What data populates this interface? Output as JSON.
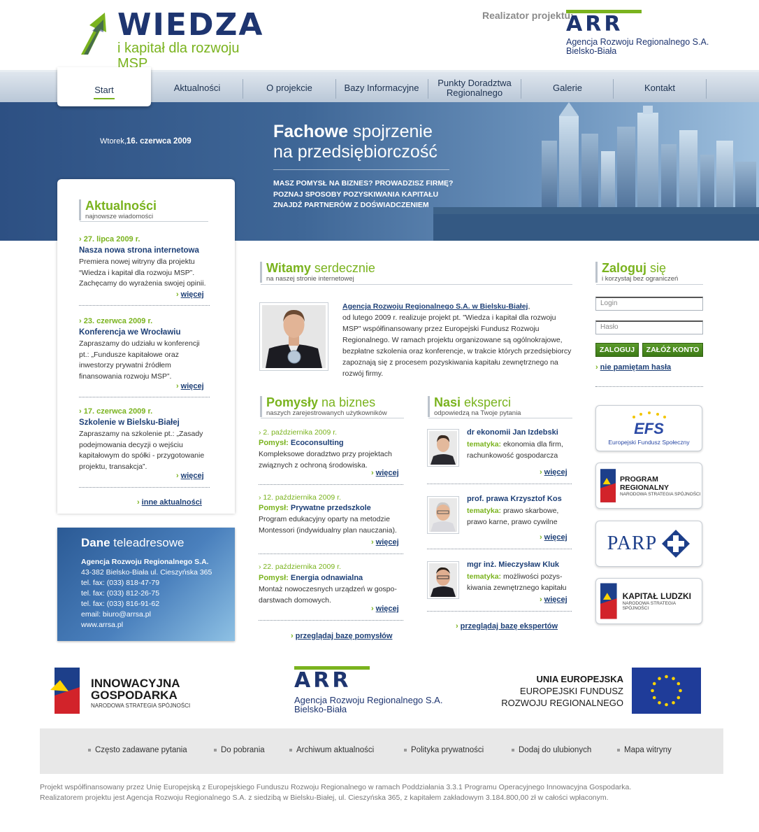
{
  "header": {
    "logo_title": "WIEDZA",
    "logo_subtitle": "i kapitał dla rozwoju MSP",
    "realizator_label": "Realizator projektu:",
    "arr_letters": "ARR",
    "arr_name_1": "Agencja Rozwoju Regionalnego S.A.",
    "arr_name_2": "Bielsko-Biała"
  },
  "nav": {
    "items": [
      {
        "label": "Start"
      },
      {
        "label": "Aktualności"
      },
      {
        "label": "O projekcie"
      },
      {
        "label": "Bazy Informacyjne"
      },
      {
        "label": "Punkty Doradztwa Regionalnego"
      },
      {
        "label": "Galerie"
      },
      {
        "label": "Kontakt"
      }
    ]
  },
  "banner": {
    "date_day": "Wtorek,",
    "date_full": "16. czerwca 2009",
    "headline_bold": "Fachowe",
    "headline_rest": " spojrzenie",
    "headline_2": "na przedsiębiorczość",
    "line_1": "MASZ POMYSŁ NA BIZNES? PROWADZISZ FIRMĘ?",
    "line_2": "POZNAJ SPOSOBY POZYSKIWANIA KAPITAŁU",
    "line_3": "ZNAJDŹ PARTNERÓW Z DOŚWIADCZENIEM"
  },
  "news": {
    "title": "Aktualności",
    "subtitle": "najnowsze wiadomości",
    "items": [
      {
        "date": "27. lipca 2009 r.",
        "title": "Nasza nowa strona internetowa",
        "text": "Premiera nowej witryny dla projektu “Wiedza i kapitał dla rozwoju MSP”. Zachęcamy do wyrażenia swojej opinii.",
        "more": "więcej"
      },
      {
        "date": "23. czerwca 2009 r.",
        "title": "Konferencja we Wrocławiu",
        "text": "Zapraszamy do udziału w konferencji pt.: „Fundusze kapitałowe oraz inwestorzy prywatni źródłem finansowania rozwoju MSP”.",
        "more": "więcej"
      },
      {
        "date": "17. czerwca 2009 r.",
        "title": "Szkolenie w Bielsku-Białej",
        "text": "Zapraszamy na szkolenie pt.: „Zasady podejmowania decyzji o wejściu kapitałowym do spółki - przygotowanie projektu, transakcja”.",
        "more": "więcej"
      }
    ],
    "other_link": "inne aktualności"
  },
  "contact": {
    "title_bold": "Dane",
    "title_rest": " teleadresowe",
    "org": "Agencja Rozwoju Regionalnego S.A.",
    "address": "43-382 Bielsko-Biała ul. Cieszyńska 365",
    "phone_1": "tel. fax: (033) 818-47-79",
    "phone_2": "tel. fax: (033) 812-26-75",
    "phone_3": "tel. fax: (033) 816-91-62",
    "email": "email: biuro@arrsa.pl",
    "www": "www.arrsa.pl"
  },
  "welcome": {
    "title_bold": "Witamy",
    "title_rest": " serdecznie",
    "subtitle": "na naszej stronie internetowej",
    "link": "Agencja Rozwoju Regionalnego S.A. w Bielsku-Białej",
    "text_after_link": ",",
    "text": "od lutego 2009 r. realizuje projekt pt. \"Wiedza i kapitał dla rozwoju MSP\" współfinansowany przez Europejski Fundusz Rozwoju Regionalnego. W ramach projektu organizowane są ogólnokrajowe, bezpłatne szkolenia oraz konferencje, w trakcie których przedsiębiorcy zapoznają się z procesem pozyskiwania kapitału zewnętrznego na rozwój firmy."
  },
  "ideas": {
    "title_bold": "Pomysły",
    "title_rest": " na biznes",
    "subtitle": "naszych zarejestrowanych użytkowników",
    "label": "Pomysł:",
    "items": [
      {
        "date": "2. października 2009 r.",
        "name": "Ecoconsulting",
        "text": "Kompleksowe doradztwo przy projektach związnych z ochroną środowiska.",
        "more": "więcej"
      },
      {
        "date": "12. października 2009 r.",
        "name": "Prywatne przedszkole",
        "text": "Program edukacyjny oparty na metodzie Montessori (indywidualny plan nauczania).",
        "more": "więcej"
      },
      {
        "date": "22. października 2009 r.",
        "name": "Energia odnawialna",
        "text": "Montaż nowoczesnych urządzeń w gospo- darstwach domowych.",
        "more": "więcej"
      }
    ],
    "browse": "przeglądaj bazę pomysłów"
  },
  "experts": {
    "title_bold": "Nasi",
    "title_rest": " eksperci",
    "subtitle": "odpowiedzą na Twoje pytania",
    "label": "tematyka:",
    "items": [
      {
        "name": "dr ekonomii Jan Izdebski",
        "topic": "ekonomia dla firm, rachunkowość gospodarcza",
        "more": "więcej"
      },
      {
        "name": "prof. prawa Krzysztof Kos",
        "topic": "prawo skarbowe, prawo karne, prawo cywilne",
        "more": "więcej"
      },
      {
        "name": "mgr inż. Mieczysław Kluk",
        "topic": "możliwości pozys- kiwania zewnętrznego kapitału",
        "more": "więcej"
      }
    ],
    "browse": "przeglądaj bazę ekspertów"
  },
  "login": {
    "title_bold": "Zaloguj",
    "title_rest": " się",
    "subtitle": "i korzystaj bez ograniczeń",
    "login_placeholder": "Login",
    "password_placeholder": "Hasło",
    "login_button": "ZALOGUJ",
    "register_button": "ZAŁÓŻ KONTO",
    "forgot": "nie pamiętam hasła"
  },
  "partners": {
    "efs_mark": "EFS",
    "efs_name": "Europejski Fundusz Społeczny",
    "program_name": "PROGRAM REGIONALNY",
    "program_sub": "NARODOWA STRATEGIA SPÓJNOŚCI",
    "parp_name": "PARP",
    "kapital_name": "KAPITAŁ LUDZKI",
    "kapital_sub": "NARODOWA STRATEGIA SPÓJNOŚCI"
  },
  "footer_logos": {
    "ig_1": "INNOWACYJNA",
    "ig_2": "GOSPODARKA",
    "ig_3": "NARODOWA STRATEGIA SPÓJNOŚCI",
    "arr_letters": "ARR",
    "arr_name_1": "Agencja Rozwoju Regionalnego S.A.",
    "arr_name_2": "Bielsko-Biała",
    "eu_1": "UNIA EUROPEJSKA",
    "eu_2": "EUROPEJSKI FUNDUSZ",
    "eu_3": "ROZWOJU REGIONALNEGO"
  },
  "footer_links": [
    {
      "label": "Często zadawane pytania"
    },
    {
      "label": "Do pobrania"
    },
    {
      "label": "Archiwum aktualności"
    },
    {
      "label": "Polityka prywatności"
    },
    {
      "label": "Dodaj do ulubionych"
    },
    {
      "label": "Mapa witryny"
    }
  ],
  "footer_text": {
    "line_1": "Projekt współfinansowany przez Unię Europejską z Europejskiego Funduszu Rozwoju Regionalnego w ramach Poddziałania 3.3.1 Programu Operacyjnego Innowacyjna Gospodarka.",
    "line_2": "Realizatorem projektu jest Agencja Rozwoju Regionalnego S.A. z siedzibą w Bielsku-Białej, ul. Cieszyńska 365, z kapitałem zakładowym 3.184.800,00 zł w całości wpłaconym."
  },
  "colors": {
    "brand_green": "#7ab31e",
    "brand_navy": "#1e3570",
    "link_blue": "#1d3f76"
  }
}
